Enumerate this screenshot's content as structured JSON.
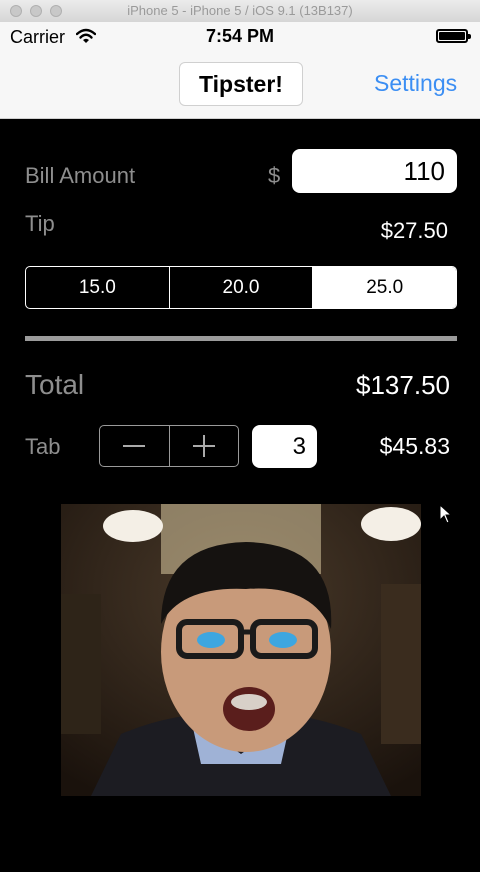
{
  "simulator": {
    "title": "iPhone 5 - iPhone 5 / iOS 9.1 (13B137)"
  },
  "status_bar": {
    "carrier": "Carrier",
    "time": "7:54 PM"
  },
  "nav": {
    "title": "Tipster!",
    "settings_label": "Settings"
  },
  "bill": {
    "label": "Bill Amount",
    "currency_symbol": "$",
    "value": "110"
  },
  "tip": {
    "label": "Tip",
    "amount": "$27.50"
  },
  "tip_options": [
    "15.0",
    "20.0",
    "25.0"
  ],
  "tip_selected": "25.0",
  "total": {
    "label": "Total",
    "amount": "$137.50"
  },
  "tab": {
    "label": "Tab",
    "count": "3",
    "per_person": "$45.83"
  },
  "colors": {
    "accent": "#3b8ef3",
    "background": "#000000",
    "label_gray": "#8e8e8e"
  },
  "icons": [
    "wifi-icon",
    "battery-icon",
    "minus-icon",
    "plus-icon",
    "cursor-icon"
  ]
}
